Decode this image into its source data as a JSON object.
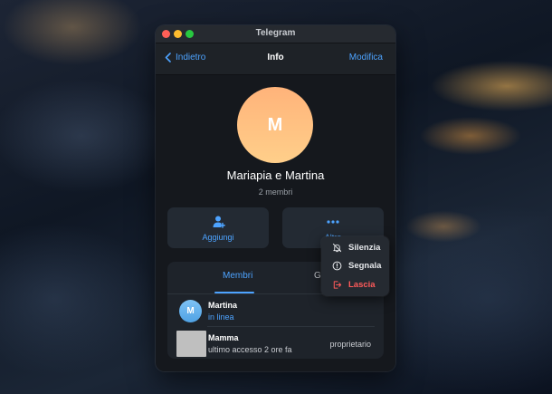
{
  "window": {
    "title": "Telegram"
  },
  "navbar": {
    "back_label": "Indietro",
    "title": "Info",
    "edit_label": "Modifica"
  },
  "profile": {
    "avatar_letter": "M",
    "name": "Mariapia e Martina",
    "subtitle": "2 membri"
  },
  "actions": {
    "add_label": "Aggiungi",
    "more_label": "Altro"
  },
  "tabs": [
    {
      "label": "Membri",
      "active": true
    },
    {
      "label": "Gl",
      "active": false
    }
  ],
  "members": [
    {
      "avatar_letter": "M",
      "name": "Martina",
      "status": "in linea",
      "role": ""
    },
    {
      "avatar_letter": "",
      "name": "Mamma",
      "status": "ultimo accesso 2 ore fa",
      "role": "proprietario"
    }
  ],
  "context_menu": {
    "items": [
      {
        "label": "Silenzia",
        "icon": "bell-slash-icon",
        "danger": false
      },
      {
        "label": "Segnala",
        "icon": "exclamation-circle-icon",
        "danger": false
      },
      {
        "label": "Lascia",
        "icon": "leave-icon",
        "danger": true
      }
    ]
  },
  "colors": {
    "accent": "#4da3ff",
    "danger": "#ff5a5a",
    "window_bg": "#15181d"
  }
}
